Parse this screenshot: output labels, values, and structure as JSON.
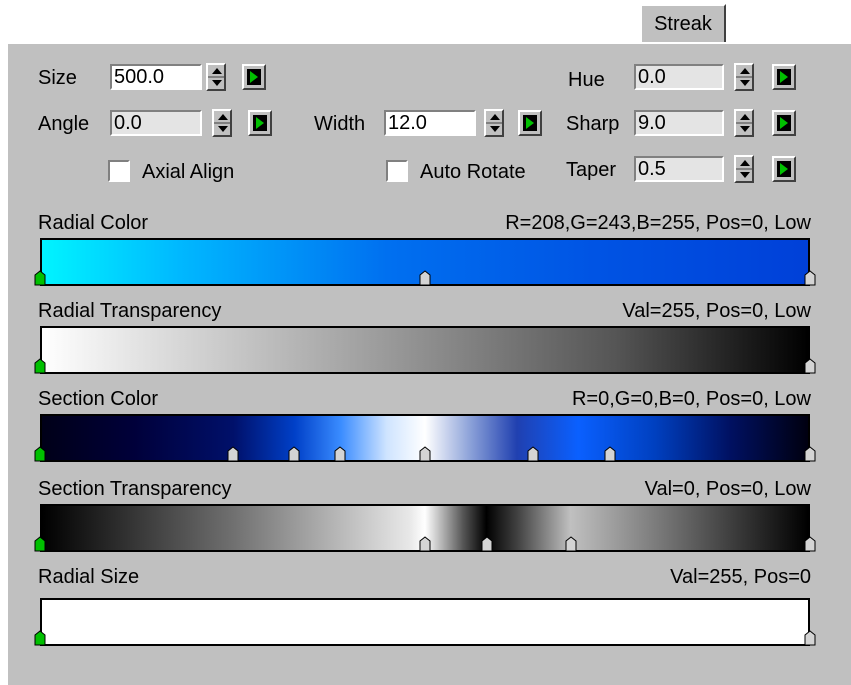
{
  "tab": {
    "label": "Streak"
  },
  "params": {
    "size": {
      "label": "Size",
      "value": "500.0"
    },
    "angle": {
      "label": "Angle",
      "value": "0.0"
    },
    "width": {
      "label": "Width",
      "value": "12.0"
    },
    "hue": {
      "label": "Hue",
      "value": "0.0"
    },
    "sharp": {
      "label": "Sharp",
      "value": "9.0"
    },
    "taper": {
      "label": "Taper",
      "value": "0.5"
    }
  },
  "checkboxes": {
    "axial_align": {
      "label": "Axial Align",
      "checked": false
    },
    "auto_rotate": {
      "label": "Auto Rotate",
      "checked": false
    }
  },
  "gradients": {
    "radial_color": {
      "label": "Radial Color",
      "value": "R=208,G=243,B=255, Pos=0, Low",
      "markers": [
        0,
        50,
        100
      ]
    },
    "radial_transparency": {
      "label": "Radial Transparency",
      "value": "Val=255, Pos=0, Low",
      "markers": [
        0,
        100
      ]
    },
    "section_color": {
      "label": "Section Color",
      "value": "R=0,G=0,B=0, Pos=0, Low",
      "markers": [
        0,
        25,
        33,
        39,
        50,
        64,
        74,
        100
      ]
    },
    "section_transparency": {
      "label": "Section Transparency",
      "value": "Val=0, Pos=0, Low",
      "markers": [
        0,
        50,
        58,
        69,
        100
      ]
    },
    "radial_size": {
      "label": "Radial Size",
      "value": "Val=255, Pos=0",
      "markers": [
        0,
        100
      ]
    }
  },
  "colors": {
    "panel": "#c0c0c0",
    "active_flag": "#00c000",
    "flag": "#d4d4d4"
  }
}
